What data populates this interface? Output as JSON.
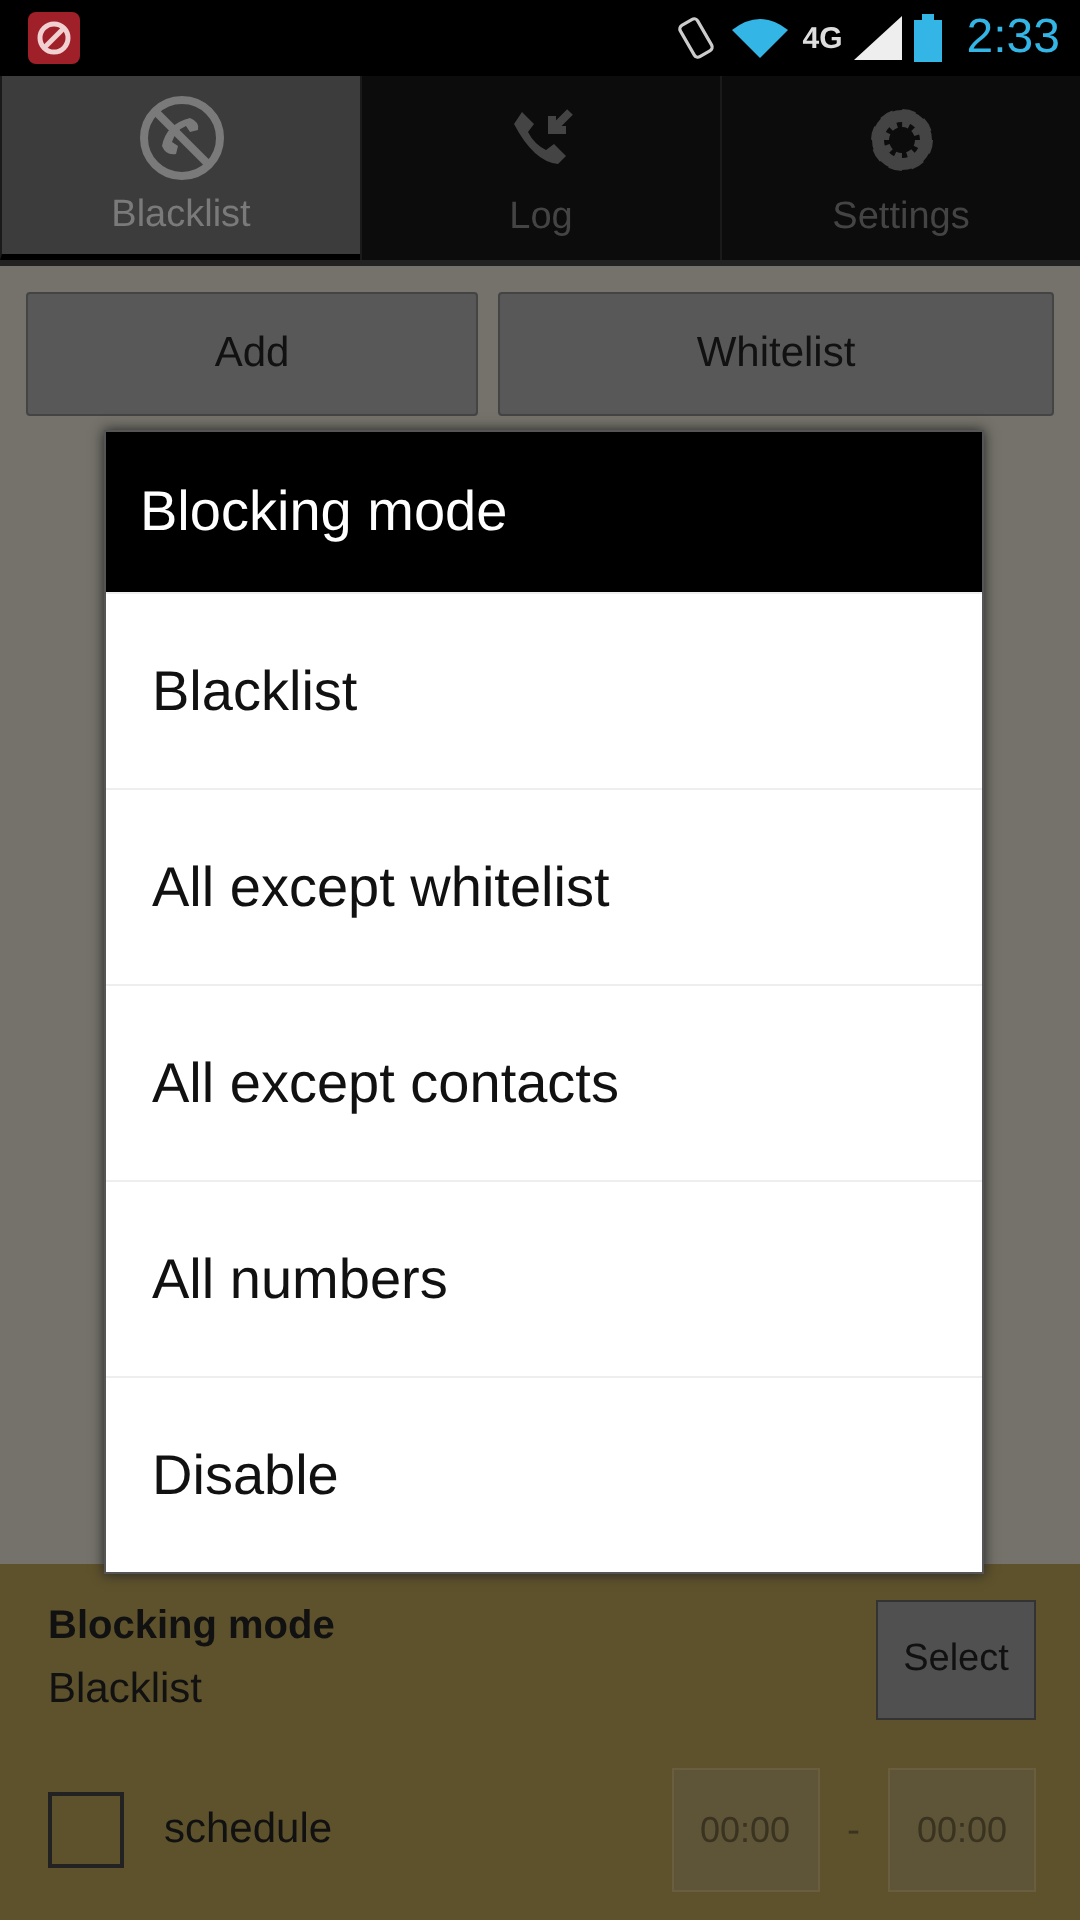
{
  "status_bar": {
    "network": "4G",
    "time": "2:33"
  },
  "tabs": [
    {
      "label": "Blacklist",
      "kind": "blocked-call",
      "selected": true
    },
    {
      "label": "Log",
      "kind": "incoming-call",
      "selected": false
    },
    {
      "label": "Settings",
      "kind": "gear",
      "selected": false
    }
  ],
  "actions": [
    "Add",
    "Whitelist"
  ],
  "dialog": {
    "title": "Blocking mode",
    "options": [
      "Blacklist",
      "All except whitelist",
      "All except contacts",
      "All numbers",
      "Disable"
    ]
  },
  "mode_panel": {
    "title": "Blocking mode",
    "value": "Blacklist",
    "button": "Select",
    "schedule": {
      "label": "schedule",
      "checked": false,
      "from": "00:00",
      "separator": "-",
      "to": "00:00",
      "disabled": true
    }
  }
}
